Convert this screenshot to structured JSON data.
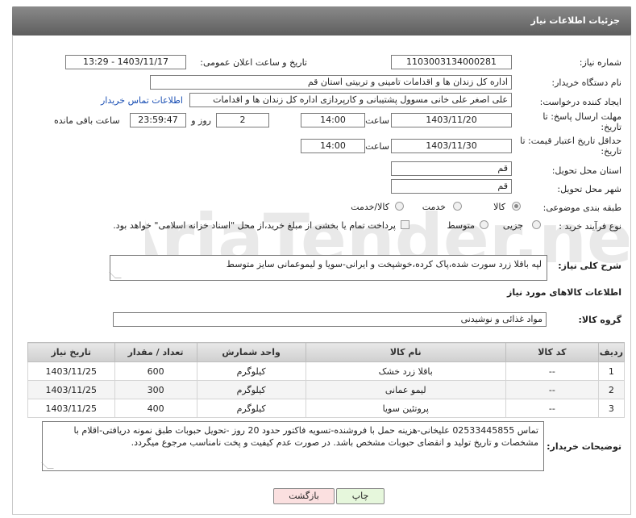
{
  "header": {
    "title": "جزئیات اطلاعات نیاز"
  },
  "fields": {
    "need_number_label": "شماره نیاز:",
    "need_number": "1103003134000281",
    "announce_label": "تاریخ و ساعت اعلان عمومی:",
    "announce_value": "1403/11/17 - 13:29",
    "buyer_org_label": "نام دستگاه خریدار:",
    "buyer_org": "اداره کل زندان ها و اقدامات تامینی و تربیتی استان قم",
    "requester_label": "ایجاد کننده درخواست:",
    "requester": "علی اصغر علی خانی مسوول پشتیبانی و کارپردازی اداره کل زندان ها و اقدامات",
    "contact_link": "اطلاعات تماس خریدار",
    "deadline_label_1": "مهلت ارسال پاسخ: تا",
    "deadline_label_2": "تاریخ:",
    "deadline_date": "1403/11/20",
    "time_label": "ساعت",
    "deadline_time": "14:00",
    "day_label": "روز و",
    "days_value": "2",
    "remaining_time": "23:59:47",
    "remaining_label": "ساعت باقی مانده",
    "validity_label_1": "حداقل تاریخ اعتبار قیمت: تا",
    "validity_label_2": "تاریخ:",
    "validity_date": "1403/11/30",
    "validity_time": "14:00",
    "province_label": "استان محل تحویل:",
    "province": "قم",
    "city_label": "شهر محل تحویل:",
    "city": "قم",
    "category_label": "طبقه بندی موضوعی:",
    "category_options": [
      "کالا",
      "خدمت",
      "کالا/خدمت"
    ],
    "process_label": "نوع فرآیند خرید :",
    "process_options": [
      "جزیی",
      "متوسط"
    ],
    "payment_note": "پرداخت تمام یا بخشی از مبلغ خرید،از محل \"اسناد خزانه اسلامی\" خواهد بود."
  },
  "description": {
    "label": "شرح کلی نیاز:",
    "text": "لپه باقلا زرد سورت شده،پاک کرده،خوشپخت و ایرانی-سویا و لیموعمانی سایز متوسط"
  },
  "goods_section": {
    "title": "اطلاعات کالاهای مورد نیاز",
    "group_label": "گروه کالا:",
    "group_value": "مواد غذائی و نوشیدنی"
  },
  "table": {
    "headers": [
      "ردیف",
      "کد کالا",
      "نام کالا",
      "واحد شمارش",
      "تعداد / مقدار",
      "تاریخ نیاز"
    ],
    "rows": [
      [
        "1",
        "--",
        "باقلا زرد خشک",
        "کیلوگرم",
        "600",
        "1403/11/25"
      ],
      [
        "2",
        "--",
        "لیمو عمانی",
        "کیلوگرم",
        "300",
        "1403/11/25"
      ],
      [
        "3",
        "--",
        "پروتئین سویا",
        "کیلوگرم",
        "400",
        "1403/11/25"
      ]
    ]
  },
  "buyer_notes": {
    "label": "توضیحات خریدار:",
    "text": "تماس 02533445855 علیخانی-هزینه حمل با فروشنده-تسویه فاکتور حدود 20 روز -تحویل حبوبات طبق نمونه دریافتی-اقلام با مشخصات و تاریخ تولید و انقضای حبوبات مشخص باشد. در صورت عدم کیفیت و پخت نامناسب مرجوع میگردد."
  },
  "buttons": {
    "print": "چاپ",
    "back": "بازگشت"
  },
  "colors": {
    "header": "#6e6e6e",
    "link": "#1a4fb4",
    "print_bg": "#e6f7dc",
    "back_bg": "#fbe0e0"
  }
}
